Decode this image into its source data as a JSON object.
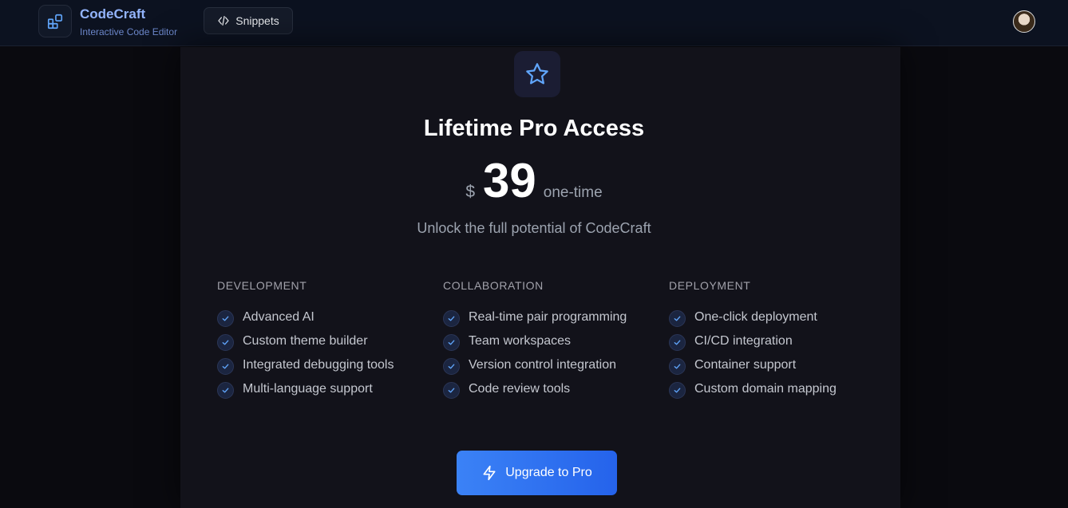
{
  "header": {
    "brand_name": "CodeCraft",
    "brand_subtitle": "Interactive Code Editor",
    "snippets_label": "Snippets"
  },
  "plan": {
    "title": "Lifetime Pro Access",
    "currency": "$",
    "price": "39",
    "price_unit": "one-time",
    "subtitle": "Unlock the full potential of CodeCraft"
  },
  "columns": [
    {
      "heading": "DEVELOPMENT",
      "features": [
        "Advanced AI",
        "Custom theme builder",
        "Integrated debugging tools",
        "Multi-language support"
      ]
    },
    {
      "heading": "COLLABORATION",
      "features": [
        "Real-time pair programming",
        "Team workspaces",
        "Version control integration",
        "Code review tools"
      ]
    },
    {
      "heading": "DEPLOYMENT",
      "features": [
        "One-click deployment",
        "CI/CD integration",
        "Container support",
        "Custom domain mapping"
      ]
    }
  ],
  "cta": {
    "label": "Upgrade to Pro"
  },
  "colors": {
    "accent": "#3b82f6",
    "brand_text": "#93b4fb",
    "card_bg": "#12121a",
    "page_bg": "#0a0a0f"
  },
  "icons": {
    "logo": "layout-grid-icon",
    "snippets": "code-icon",
    "plan": "star-icon",
    "feature": "check-icon",
    "cta": "zap-icon"
  }
}
